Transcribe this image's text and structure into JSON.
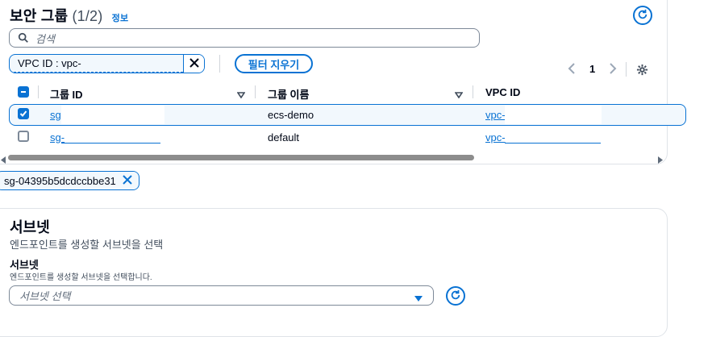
{
  "header": {
    "title": "보안 그룹",
    "count": "(1/2)",
    "info_label": "정보",
    "refresh_icon": "refresh-icon"
  },
  "search": {
    "placeholder": "검색",
    "icon": "search-icon"
  },
  "filter": {
    "token_text": "VPC ID : vpc-",
    "clear_button_label": "필터 지우기"
  },
  "pagination": {
    "current_page": "1"
  },
  "table": {
    "columns": [
      "그룹 ID",
      "그룹 이름",
      "VPC ID"
    ],
    "rows": [
      {
        "group_id": "sg-",
        "group_name": "ecs-demo",
        "vpc_id": "vpc-",
        "selected": true
      },
      {
        "group_id": "sg-",
        "group_name": "default",
        "vpc_id": "vpc-",
        "selected": false
      }
    ]
  },
  "selected_token": {
    "label": "sg-04395b5dcdccbbe31"
  },
  "subnet_section": {
    "title": "서브넷",
    "description": "엔드포인트를 생성할 서브넷을 선택",
    "field_label": "서브넷",
    "field_description": "엔드포인트를 생성할 서브넷을 선택합니다.",
    "select_placeholder": "서브넷 선택"
  },
  "colors": {
    "accent": "#0972d3",
    "border": "#7d8998",
    "text": "#000716"
  }
}
